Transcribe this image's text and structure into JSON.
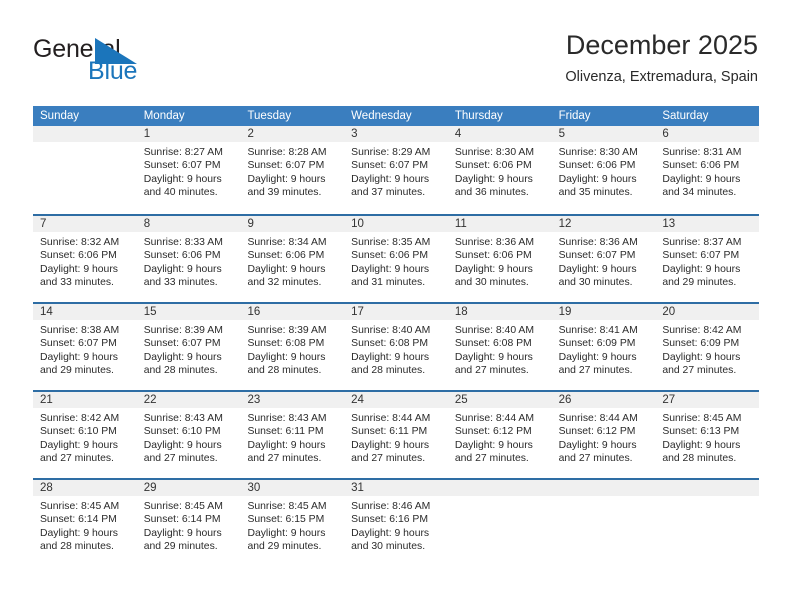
{
  "brand": {
    "name_part1": "General",
    "name_part2": "Blue",
    "logo_icon": "triangle-logo-icon",
    "colors": {
      "dark": "#231f20",
      "blue": "#1b75bb"
    }
  },
  "header": {
    "title": "December 2025",
    "subtitle": "Olivenza, Extremadura, Spain"
  },
  "colors": {
    "header_band": "#3a7ebf",
    "row_divider": "#2e6da4",
    "daynum_band": "#f0f0f0"
  },
  "calendar": {
    "weekday_headers": [
      "Sunday",
      "Monday",
      "Tuesday",
      "Wednesday",
      "Thursday",
      "Friday",
      "Saturday"
    ],
    "weeks": [
      [
        {
          "day": "",
          "lines": []
        },
        {
          "day": "1",
          "lines": [
            "Sunrise: 8:27 AM",
            "Sunset: 6:07 PM",
            "Daylight: 9 hours",
            "and 40 minutes."
          ]
        },
        {
          "day": "2",
          "lines": [
            "Sunrise: 8:28 AM",
            "Sunset: 6:07 PM",
            "Daylight: 9 hours",
            "and 39 minutes."
          ]
        },
        {
          "day": "3",
          "lines": [
            "Sunrise: 8:29 AM",
            "Sunset: 6:07 PM",
            "Daylight: 9 hours",
            "and 37 minutes."
          ]
        },
        {
          "day": "4",
          "lines": [
            "Sunrise: 8:30 AM",
            "Sunset: 6:06 PM",
            "Daylight: 9 hours",
            "and 36 minutes."
          ]
        },
        {
          "day": "5",
          "lines": [
            "Sunrise: 8:30 AM",
            "Sunset: 6:06 PM",
            "Daylight: 9 hours",
            "and 35 minutes."
          ]
        },
        {
          "day": "6",
          "lines": [
            "Sunrise: 8:31 AM",
            "Sunset: 6:06 PM",
            "Daylight: 9 hours",
            "and 34 minutes."
          ]
        }
      ],
      [
        {
          "day": "7",
          "lines": [
            "Sunrise: 8:32 AM",
            "Sunset: 6:06 PM",
            "Daylight: 9 hours",
            "and 33 minutes."
          ]
        },
        {
          "day": "8",
          "lines": [
            "Sunrise: 8:33 AM",
            "Sunset: 6:06 PM",
            "Daylight: 9 hours",
            "and 33 minutes."
          ]
        },
        {
          "day": "9",
          "lines": [
            "Sunrise: 8:34 AM",
            "Sunset: 6:06 PM",
            "Daylight: 9 hours",
            "and 32 minutes."
          ]
        },
        {
          "day": "10",
          "lines": [
            "Sunrise: 8:35 AM",
            "Sunset: 6:06 PM",
            "Daylight: 9 hours",
            "and 31 minutes."
          ]
        },
        {
          "day": "11",
          "lines": [
            "Sunrise: 8:36 AM",
            "Sunset: 6:06 PM",
            "Daylight: 9 hours",
            "and 30 minutes."
          ]
        },
        {
          "day": "12",
          "lines": [
            "Sunrise: 8:36 AM",
            "Sunset: 6:07 PM",
            "Daylight: 9 hours",
            "and 30 minutes."
          ]
        },
        {
          "day": "13",
          "lines": [
            "Sunrise: 8:37 AM",
            "Sunset: 6:07 PM",
            "Daylight: 9 hours",
            "and 29 minutes."
          ]
        }
      ],
      [
        {
          "day": "14",
          "lines": [
            "Sunrise: 8:38 AM",
            "Sunset: 6:07 PM",
            "Daylight: 9 hours",
            "and 29 minutes."
          ]
        },
        {
          "day": "15",
          "lines": [
            "Sunrise: 8:39 AM",
            "Sunset: 6:07 PM",
            "Daylight: 9 hours",
            "and 28 minutes."
          ]
        },
        {
          "day": "16",
          "lines": [
            "Sunrise: 8:39 AM",
            "Sunset: 6:08 PM",
            "Daylight: 9 hours",
            "and 28 minutes."
          ]
        },
        {
          "day": "17",
          "lines": [
            "Sunrise: 8:40 AM",
            "Sunset: 6:08 PM",
            "Daylight: 9 hours",
            "and 28 minutes."
          ]
        },
        {
          "day": "18",
          "lines": [
            "Sunrise: 8:40 AM",
            "Sunset: 6:08 PM",
            "Daylight: 9 hours",
            "and 27 minutes."
          ]
        },
        {
          "day": "19",
          "lines": [
            "Sunrise: 8:41 AM",
            "Sunset: 6:09 PM",
            "Daylight: 9 hours",
            "and 27 minutes."
          ]
        },
        {
          "day": "20",
          "lines": [
            "Sunrise: 8:42 AM",
            "Sunset: 6:09 PM",
            "Daylight: 9 hours",
            "and 27 minutes."
          ]
        }
      ],
      [
        {
          "day": "21",
          "lines": [
            "Sunrise: 8:42 AM",
            "Sunset: 6:10 PM",
            "Daylight: 9 hours",
            "and 27 minutes."
          ]
        },
        {
          "day": "22",
          "lines": [
            "Sunrise: 8:43 AM",
            "Sunset: 6:10 PM",
            "Daylight: 9 hours",
            "and 27 minutes."
          ]
        },
        {
          "day": "23",
          "lines": [
            "Sunrise: 8:43 AM",
            "Sunset: 6:11 PM",
            "Daylight: 9 hours",
            "and 27 minutes."
          ]
        },
        {
          "day": "24",
          "lines": [
            "Sunrise: 8:44 AM",
            "Sunset: 6:11 PM",
            "Daylight: 9 hours",
            "and 27 minutes."
          ]
        },
        {
          "day": "25",
          "lines": [
            "Sunrise: 8:44 AM",
            "Sunset: 6:12 PM",
            "Daylight: 9 hours",
            "and 27 minutes."
          ]
        },
        {
          "day": "26",
          "lines": [
            "Sunrise: 8:44 AM",
            "Sunset: 6:12 PM",
            "Daylight: 9 hours",
            "and 27 minutes."
          ]
        },
        {
          "day": "27",
          "lines": [
            "Sunrise: 8:45 AM",
            "Sunset: 6:13 PM",
            "Daylight: 9 hours",
            "and 28 minutes."
          ]
        }
      ],
      [
        {
          "day": "28",
          "lines": [
            "Sunrise: 8:45 AM",
            "Sunset: 6:14 PM",
            "Daylight: 9 hours",
            "and 28 minutes."
          ]
        },
        {
          "day": "29",
          "lines": [
            "Sunrise: 8:45 AM",
            "Sunset: 6:14 PM",
            "Daylight: 9 hours",
            "and 29 minutes."
          ]
        },
        {
          "day": "30",
          "lines": [
            "Sunrise: 8:45 AM",
            "Sunset: 6:15 PM",
            "Daylight: 9 hours",
            "and 29 minutes."
          ]
        },
        {
          "day": "31",
          "lines": [
            "Sunrise: 8:46 AM",
            "Sunset: 6:16 PM",
            "Daylight: 9 hours",
            "and 30 minutes."
          ]
        },
        {
          "day": "",
          "lines": []
        },
        {
          "day": "",
          "lines": []
        },
        {
          "day": "",
          "lines": []
        }
      ]
    ]
  }
}
